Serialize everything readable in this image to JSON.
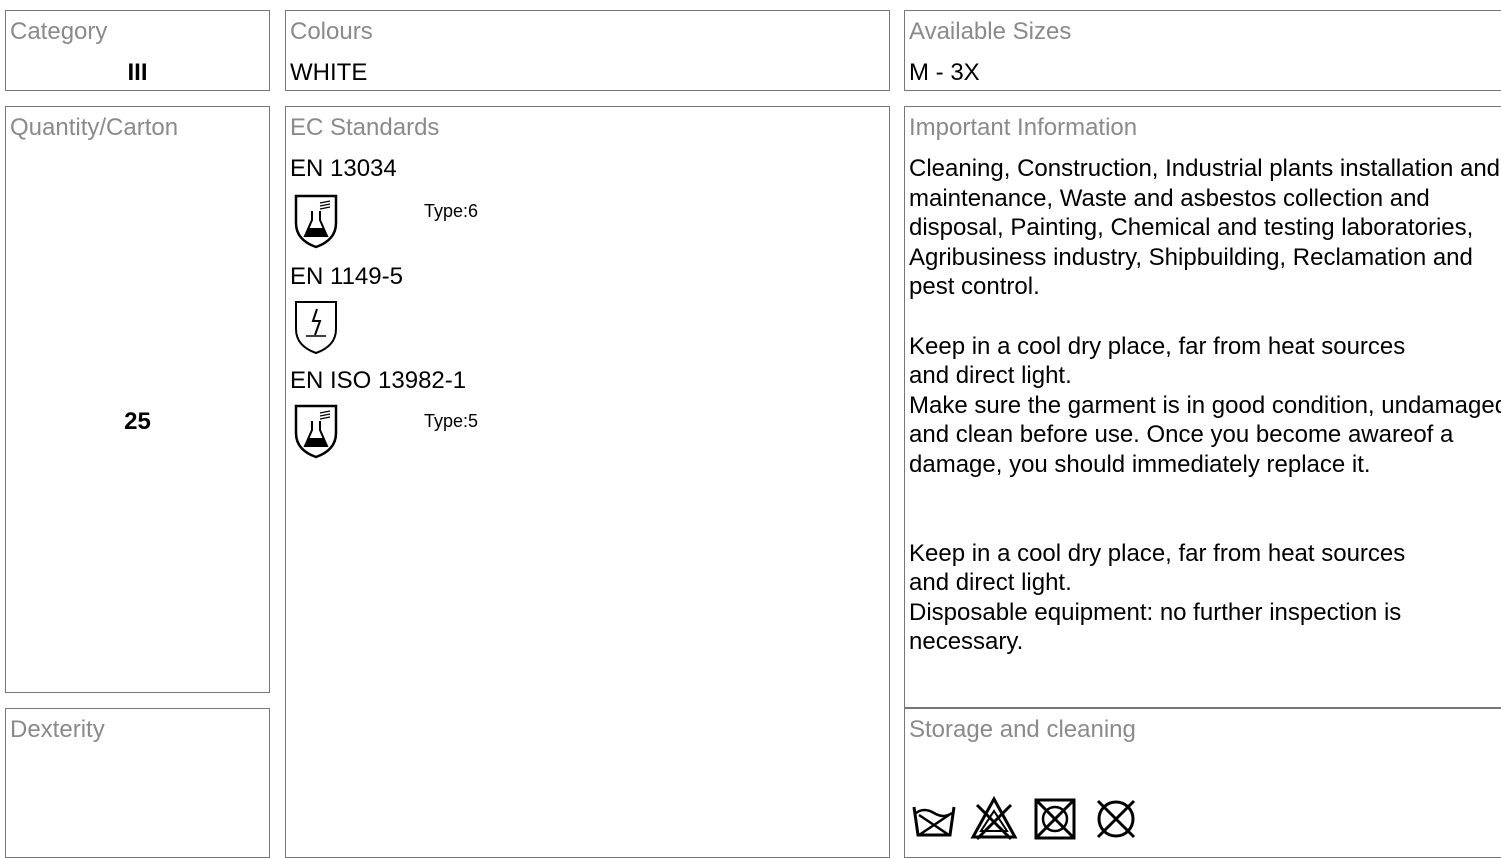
{
  "category": {
    "label": "Category",
    "value": "III"
  },
  "colours": {
    "label": "Colours",
    "value": "WHITE"
  },
  "sizes": {
    "label": "Available Sizes",
    "value": "M - 3X"
  },
  "quantity": {
    "label": "Quantity/Carton",
    "value": "25"
  },
  "dexterity": {
    "label": "Dexterity"
  },
  "ec_standards": {
    "label": "EC Standards",
    "items": [
      {
        "code": "EN 13034",
        "icon": "chemical-protection-icon",
        "type": "Type:6"
      },
      {
        "code": "EN 1149-5",
        "icon": "antistatic-icon"
      },
      {
        "code": "EN ISO 13982-1",
        "icon": "chemical-protection-icon",
        "type": "Type:5"
      }
    ]
  },
  "important_info": {
    "label": "Important Information",
    "paragraphs": [
      "Cleaning, Construction, Industrial plants installation and maintenance, Waste and asbestos collection and disposal, Painting, Chemical and testing laboratories, Agribusiness industry, Shipbuilding, Reclamation and pest control.",
      "Keep in a cool dry place, far from heat sources\nand direct light.\nMake sure the garment is in good condition, undamaged and clean before use. Once you become awareof a damage, you should immediately replace it.",
      "Keep in a cool dry place, far from heat sources\nand direct light.\nDisposable equipment: no further inspection is necessary."
    ]
  },
  "storage": {
    "label": "Storage and cleaning",
    "icons": [
      "do-not-wash-icon",
      "do-not-bleach-icon",
      "do-not-tumble-dry-icon",
      "do-not-dry-clean-icon"
    ]
  }
}
